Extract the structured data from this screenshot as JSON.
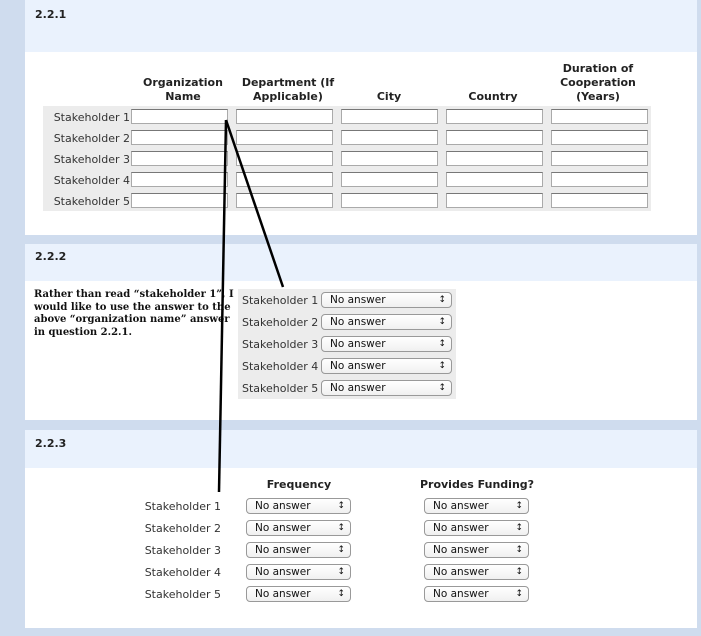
{
  "section1": {
    "title": "2.2.1",
    "columns": [
      "Organization Name",
      "Department (If Applicable)",
      "City",
      "Country",
      "Duration of Cooperation (Years)"
    ],
    "rows": [
      "Stakeholder 1",
      "Stakeholder 2",
      "Stakeholder 3",
      "Stakeholder 4",
      "Stakeholder 5"
    ]
  },
  "section2": {
    "title": "2.2.2",
    "note": "Rather than read “stakeholder 1”, I would like to use the answer to the above “organization name” answer in question 2.2.1.",
    "rows": [
      {
        "label": "Stakeholder 1",
        "value": "No answer"
      },
      {
        "label": "Stakeholder 2",
        "value": "No answer"
      },
      {
        "label": "Stakeholder 3",
        "value": "No answer"
      },
      {
        "label": "Stakeholder 4",
        "value": "No answer"
      },
      {
        "label": "Stakeholder 5",
        "value": "No answer"
      }
    ]
  },
  "section3": {
    "title": "2.2.3",
    "col_frequency": "Frequency",
    "col_funding": "Provides Funding?",
    "rows": [
      {
        "label": "Stakeholder 1",
        "frequency": "No answer",
        "funding": "No answer"
      },
      {
        "label": "Stakeholder 2",
        "frequency": "No answer",
        "funding": "No answer"
      },
      {
        "label": "Stakeholder 3",
        "frequency": "No answer",
        "funding": "No answer"
      },
      {
        "label": "Stakeholder 4",
        "frequency": "No answer",
        "funding": "No answer"
      },
      {
        "label": "Stakeholder 5",
        "frequency": "No answer",
        "funding": "No answer"
      }
    ]
  },
  "icons": {
    "select_arrow": "updown-arrow-icon"
  }
}
